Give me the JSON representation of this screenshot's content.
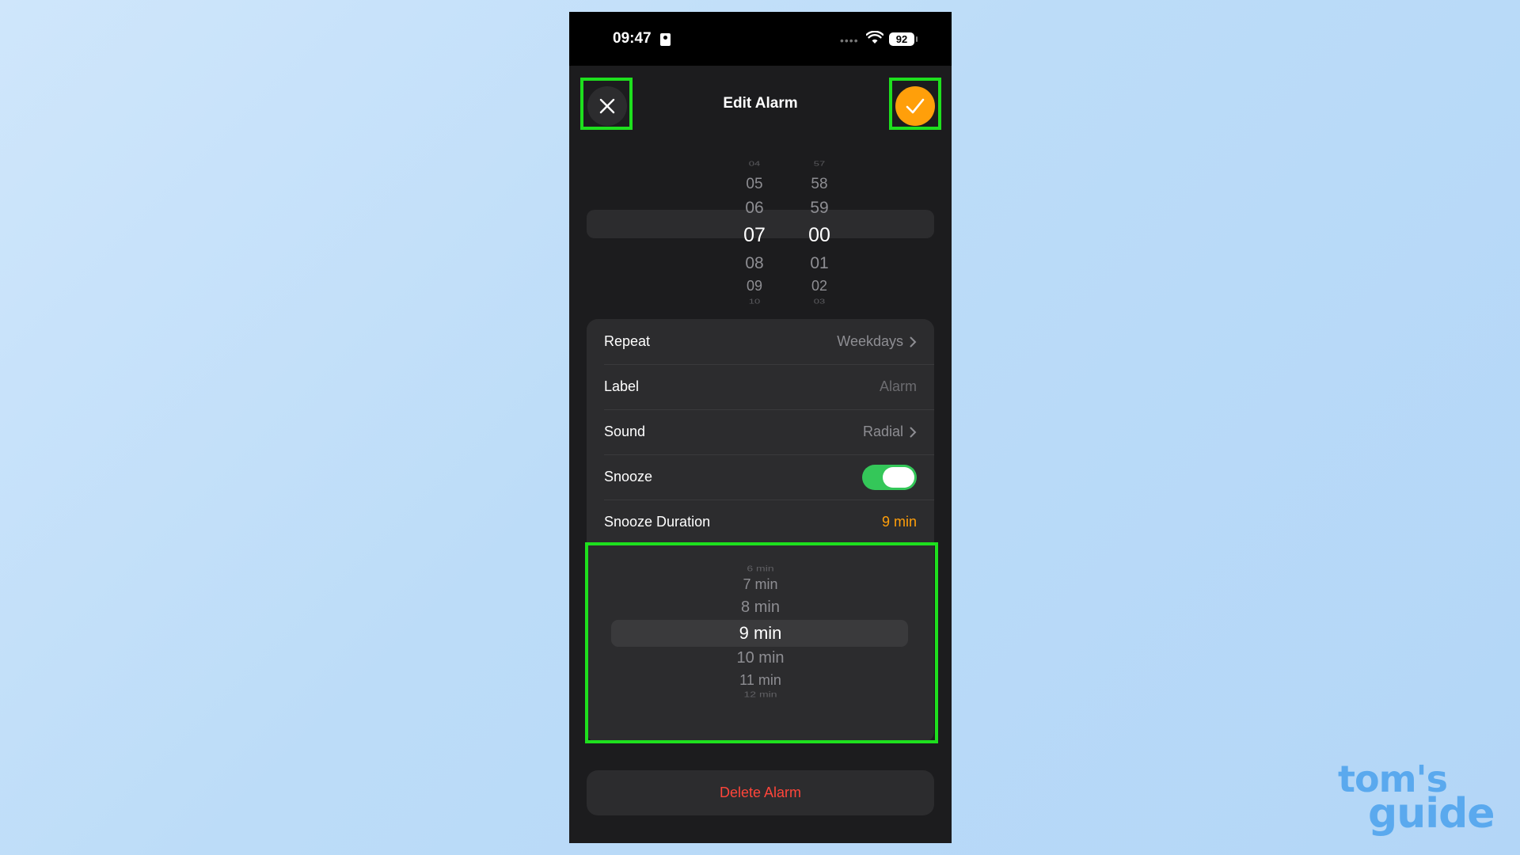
{
  "status_bar": {
    "time": "09:47",
    "battery": "92",
    "signal_dots": "•••• "
  },
  "nav": {
    "title": "Edit Alarm",
    "close_icon": "close-icon",
    "done_icon": "checkmark-icon"
  },
  "time_picker": {
    "hours": [
      "04",
      "05",
      "06",
      "07",
      "08",
      "09",
      "10"
    ],
    "minutes": [
      "57",
      "58",
      "59",
      "00",
      "01",
      "02",
      "03"
    ],
    "selected_hour": "07",
    "selected_minute": "00"
  },
  "settings": {
    "repeat": {
      "label": "Repeat",
      "value": "Weekdays"
    },
    "label": {
      "label": "Label",
      "placeholder": "Alarm"
    },
    "sound": {
      "label": "Sound",
      "value": "Radial"
    },
    "snooze": {
      "label": "Snooze",
      "on": true
    },
    "snooze_duration": {
      "label": "Snooze Duration",
      "value": "9 min"
    }
  },
  "snooze_picker": {
    "items": [
      "6 min",
      "7 min",
      "8 min",
      "9 min",
      "10 min",
      "11 min",
      "12 min"
    ],
    "selected": "9 min"
  },
  "delete_label": "Delete Alarm",
  "watermark": {
    "line1": "tom's",
    "line2": "guide"
  },
  "colors": {
    "accent": "#ff9f0a",
    "toggle_on": "#34c759",
    "destructive": "#ff453a",
    "highlight": "#1ee01e"
  }
}
